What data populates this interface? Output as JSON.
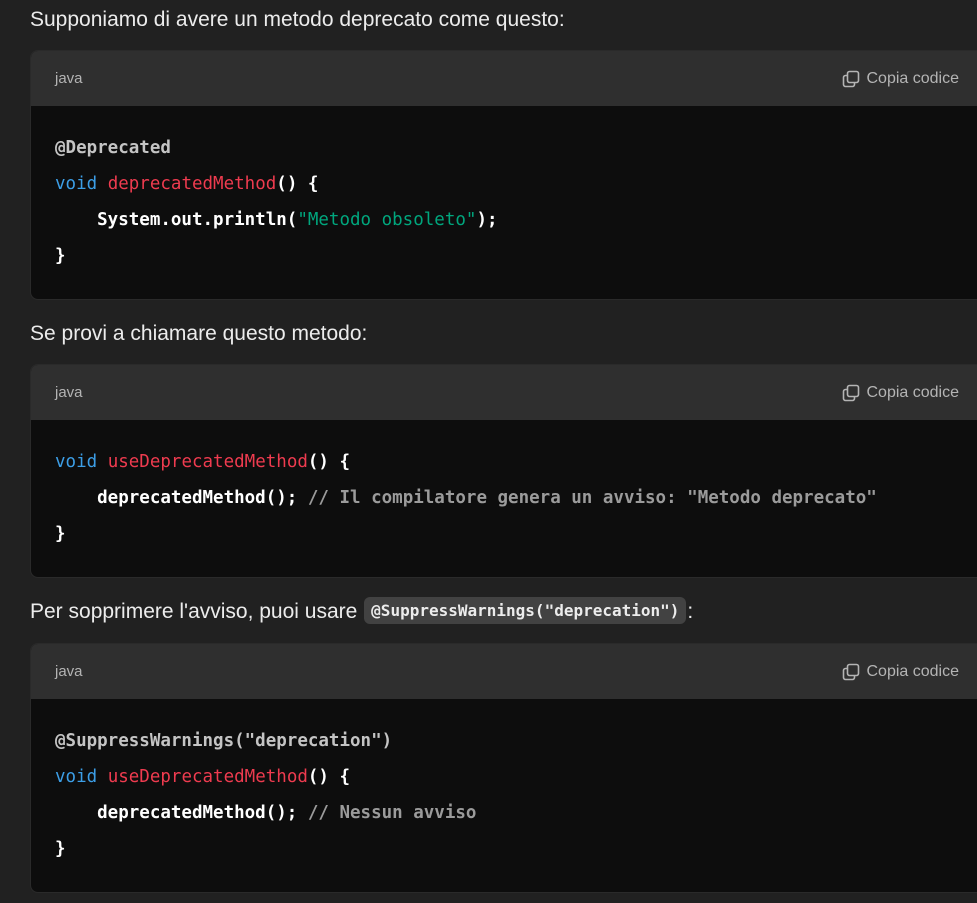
{
  "paragraphs": {
    "p1": "Supponiamo di avere un metodo deprecato come questo:",
    "p2": "Se provi a chiamare questo metodo:",
    "p3_before": "Per sopprimere l'avviso, puoi usare ",
    "p3_code": "@SuppressWarnings(\"deprecation\")",
    "p3_after": ":"
  },
  "code_blocks": [
    {
      "language": "java",
      "copy_label": "Copia codice",
      "lines": [
        [
          {
            "t": "ann",
            "v": "@Deprecated"
          }
        ],
        [
          {
            "t": "kw",
            "v": "void"
          },
          {
            "t": "pl",
            "v": " "
          },
          {
            "t": "fn",
            "v": "deprecatedMethod"
          },
          {
            "t": "pl",
            "v": "() {"
          }
        ],
        [
          {
            "t": "pl",
            "v": "    System.out.println("
          },
          {
            "t": "str",
            "v": "\"Metodo obsoleto\""
          },
          {
            "t": "pl",
            "v": ");"
          }
        ],
        [
          {
            "t": "pl",
            "v": "}"
          }
        ]
      ]
    },
    {
      "language": "java",
      "copy_label": "Copia codice",
      "lines": [
        [
          {
            "t": "kw",
            "v": "void"
          },
          {
            "t": "pl",
            "v": " "
          },
          {
            "t": "fn",
            "v": "useDeprecatedMethod"
          },
          {
            "t": "pl",
            "v": "() {"
          }
        ],
        [
          {
            "t": "pl",
            "v": "    deprecatedMethod(); "
          },
          {
            "t": "cm",
            "v": "// Il compilatore genera un avviso: \"Metodo deprecato\""
          }
        ],
        [
          {
            "t": "pl",
            "v": "}"
          }
        ]
      ]
    },
    {
      "language": "java",
      "copy_label": "Copia codice",
      "lines": [
        [
          {
            "t": "ann",
            "v": "@SuppressWarnings(\"deprecation\")"
          }
        ],
        [
          {
            "t": "kw",
            "v": "void"
          },
          {
            "t": "pl",
            "v": " "
          },
          {
            "t": "fn",
            "v": "useDeprecatedMethod"
          },
          {
            "t": "pl",
            "v": "() {"
          }
        ],
        [
          {
            "t": "pl",
            "v": "    deprecatedMethod(); "
          },
          {
            "t": "cm",
            "v": "// Nessun avviso"
          }
        ],
        [
          {
            "t": "pl",
            "v": "}"
          }
        ]
      ]
    }
  ],
  "icons": {
    "copy": "copy-icon"
  },
  "colors": {
    "background": "#212121",
    "code_header": "#2f2f2f",
    "code_body": "#0d0d0d",
    "keyword": "#3c9ee6",
    "function": "#ee3b4f",
    "string": "#00a67d",
    "comment": "#9b9b9b"
  }
}
